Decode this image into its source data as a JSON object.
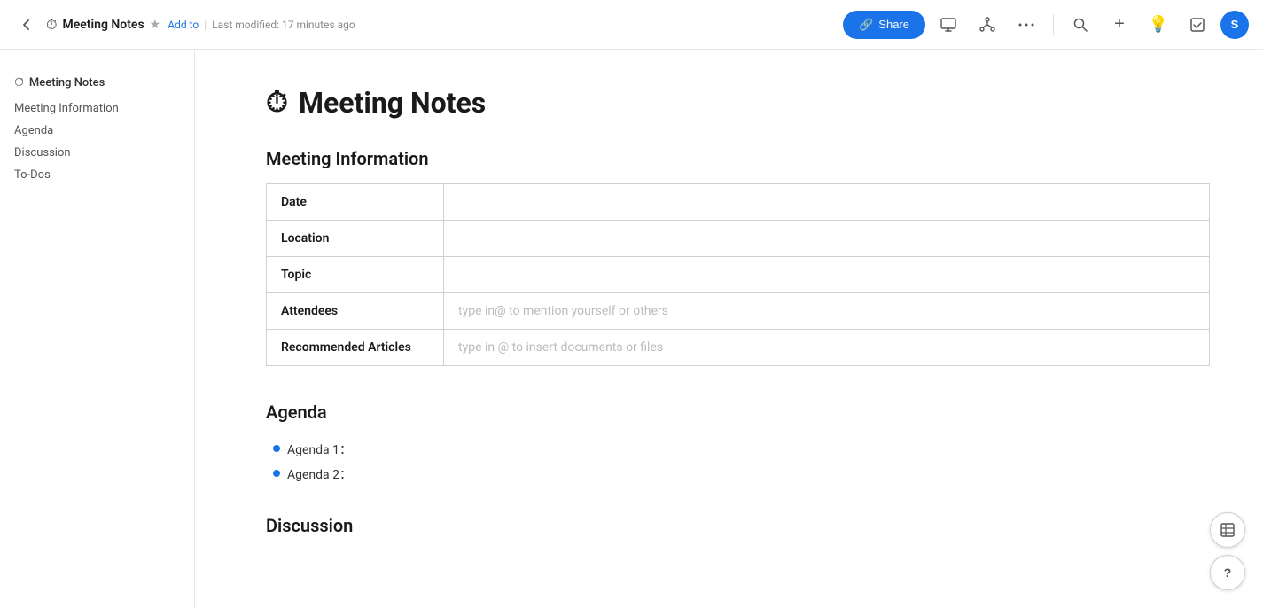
{
  "topbar": {
    "doc_title": "Meeting Notes",
    "doc_icon": "⏱",
    "star_icon": "★",
    "add_to": "Add to",
    "last_modified": "Last modified: 17 minutes ago",
    "share_label": "Share",
    "share_icon": "🔗",
    "avatar_letter": "S",
    "avatar_color": "#1a73e8"
  },
  "sidebar": {
    "doc_link_icon": "⏱",
    "doc_link_label": "Meeting Notes",
    "nav_items": [
      {
        "label": "Meeting Information"
      },
      {
        "label": "Agenda"
      },
      {
        "label": "Discussion"
      },
      {
        "label": "To-Dos"
      }
    ]
  },
  "main": {
    "title_icon": "⏱",
    "title": "Meeting Notes",
    "section1_heading": "Meeting Information",
    "table_rows": [
      {
        "label": "Date",
        "value": "",
        "placeholder": ""
      },
      {
        "label": "Location",
        "value": "",
        "placeholder": ""
      },
      {
        "label": "Topic",
        "value": "",
        "placeholder": ""
      },
      {
        "label": "Attendees",
        "value": "type in@ to mention yourself or others"
      },
      {
        "label": "Recommended Articles",
        "value": "type in @ to insert documents or files"
      }
    ],
    "section2_heading": "Agenda",
    "agenda_items": [
      {
        "label": "Agenda 1："
      },
      {
        "label": "Agenda 2："
      }
    ],
    "section3_heading": "Discussion"
  },
  "icons": {
    "back": "‹",
    "present": "⬜",
    "share_tree": "⑂",
    "more": "···",
    "search": "🔍",
    "add": "+",
    "bulb": "💡",
    "checkbox": "☑",
    "table_icon": "⊞",
    "help": "?"
  }
}
